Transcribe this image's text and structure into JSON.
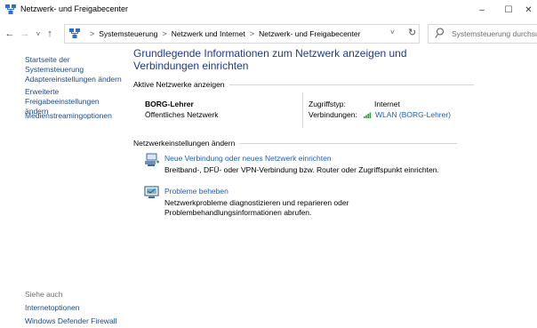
{
  "window": {
    "title": "Netzwerk- und Freigabecenter",
    "controls": {
      "minimize": "–",
      "maximize": "☐",
      "close": "✕"
    }
  },
  "navigation": {
    "back": "←",
    "forward": "→",
    "recent": "˅",
    "up": "↑",
    "breadcrumbs": [
      "Systemsteuerung",
      "Netzwerk und Internet",
      "Netzwerk- und Freigabecenter"
    ],
    "separator": ">",
    "dropdown": "˅",
    "refresh": "↻",
    "search_placeholder": "Systemsteuerung durchsuchen"
  },
  "left_pane": {
    "links": [
      "Startseite der Systemsteuerung",
      "Adaptereinstellungen ändern",
      "Erweiterte Freigabeeinstellungen ändern",
      "Medienstreamingoptionen"
    ],
    "see_also_label": "Siehe auch",
    "see_also_links": [
      "Internetoptionen",
      "Windows Defender Firewall"
    ]
  },
  "main": {
    "title": "Grundlegende Informationen zum Netzwerk anzeigen und Verbindungen einrichten",
    "active_networks_heading": "Aktive Netzwerke anzeigen",
    "network": {
      "name": "BORG-Lehrer",
      "category": "Öffentliches Netzwerk",
      "access_type_label": "Zugriffstyp:",
      "access_type_value": "Internet",
      "connections_label": "Verbindungen:",
      "connections_value": "WLAN (BORG-Lehrer)"
    },
    "change_settings_heading": "Netzwerkeinstellungen ändern",
    "tasks": [
      {
        "icon": "new-connection-icon",
        "title": "Neue Verbindung oder neues Netzwerk einrichten",
        "description": "Breitband-, DFÜ- oder VPN-Verbindung bzw. Router oder Zugriffspunkt einrichten."
      },
      {
        "icon": "troubleshoot-icon",
        "title": "Probleme beheben",
        "description": "Netzwerkprobleme diagnostizieren und reparieren oder Problembehandlungsinformationen abrufen."
      }
    ]
  },
  "colors": {
    "title_blue": "#1e3a8a",
    "link_blue": "#1a5fb4",
    "left_link_blue": "#1a4a8b",
    "wifi_green": "#3a9a3a"
  }
}
